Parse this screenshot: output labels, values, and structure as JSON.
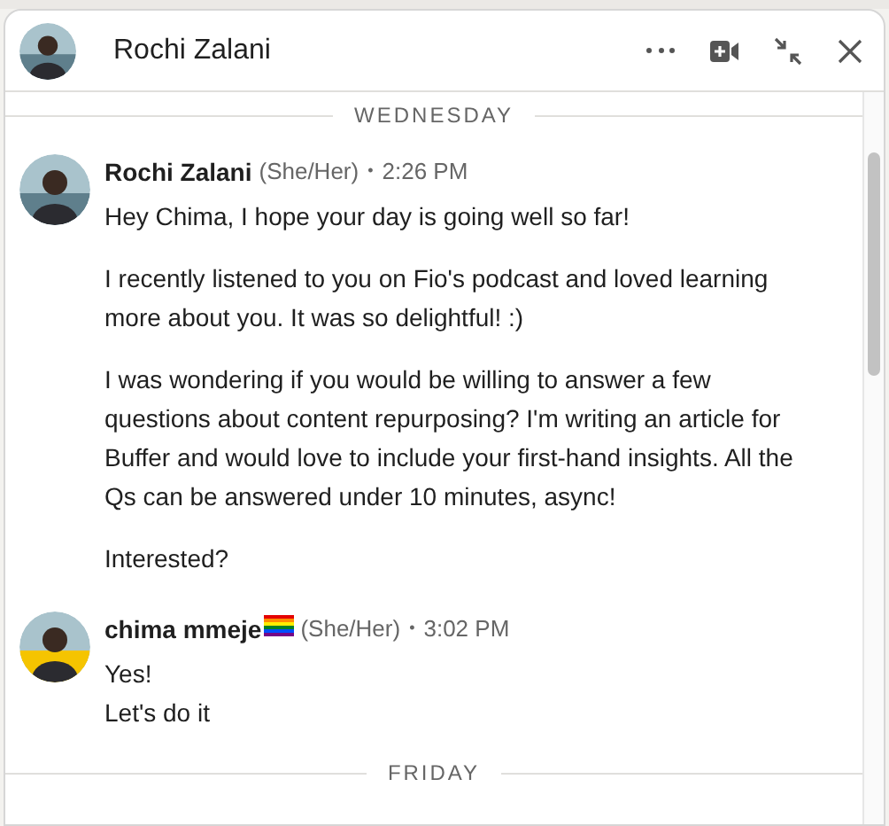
{
  "header": {
    "title": "Rochi Zalani"
  },
  "days": [
    {
      "label": "WEDNESDAY",
      "messages": [
        {
          "sender": "Rochi Zalani",
          "flag": false,
          "pronouns": "(She/Her)",
          "separator": "•",
          "time": "2:26 PM",
          "paragraphs": [
            "Hey Chima, I hope your day is going well so far!",
            "I recently listened to you on Fio's podcast and loved learning more about you. It was so delightful! :)",
            "I was wondering if you would be willing to answer a few questions about content repurposing? I'm writing an article for Buffer and would love to include your first-hand insights. All the Qs can be answered under 10 minutes, async!",
            "Interested?"
          ]
        },
        {
          "sender": "chima mmeje",
          "flag": true,
          "pronouns": "(She/Her)",
          "separator": "•",
          "time": "3:02 PM",
          "lines": [
            "Yes!",
            "Let's do it"
          ]
        }
      ]
    },
    {
      "label": "FRIDAY"
    }
  ]
}
